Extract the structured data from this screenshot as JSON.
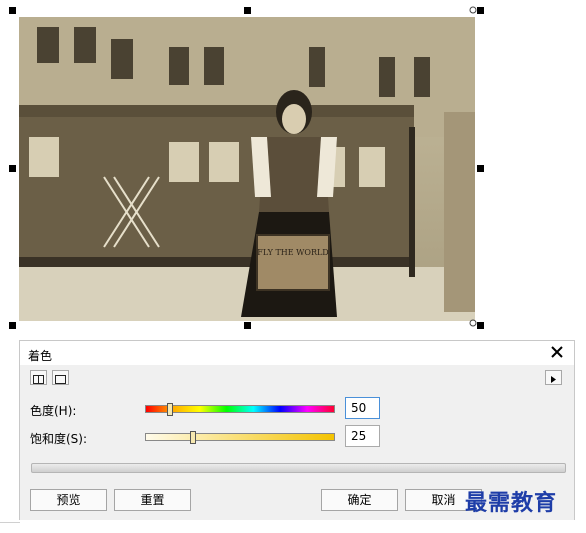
{
  "photo": {
    "description_icon": "photo-icon"
  },
  "dialog": {
    "title": "着色",
    "hue": {
      "label": "色度(H):",
      "value": "50",
      "level_percent": 13
    },
    "saturation": {
      "label": "饱和度(S):",
      "value": "25",
      "level_percent": 25
    },
    "buttons": {
      "preview": "预览",
      "reset": "重置",
      "ok": "确定",
      "cancel": "取消"
    }
  },
  "watermark": "最需教育"
}
